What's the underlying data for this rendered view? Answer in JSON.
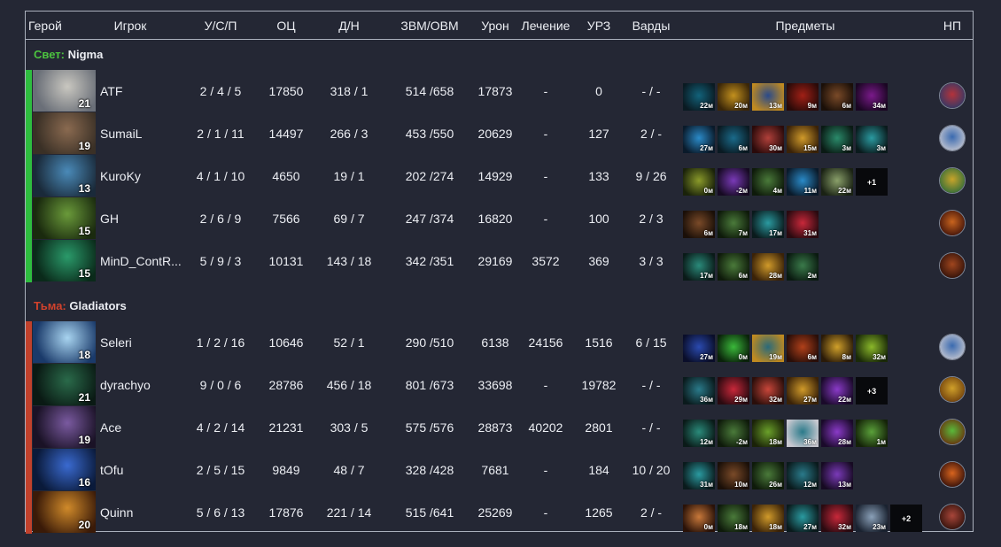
{
  "headers": {
    "hero": "Герой",
    "player": "Игрок",
    "kda": "У/С/П",
    "nw": "ОЦ",
    "lhdn": "Д/Н",
    "gpmxpm": "ЗВМ/ОВМ",
    "damage": "Урон",
    "heal": "Лечение",
    "tower_damage": "УРЗ",
    "wards": "Варды",
    "items": "Предметы",
    "np": "НП"
  },
  "teams": [
    {
      "side": "Свет:",
      "name": "Nigma",
      "side_color": "#4cc33f",
      "bar_color": "#2ebd3f",
      "rows": [
        {
          "level": "21",
          "player": "ATF",
          "kda": "2 / 4 / 5",
          "nw": "17850",
          "lhdn": "318 / 1",
          "gpmxpm": "514 /658",
          "damage": "17873",
          "heal": "-",
          "td": "0",
          "wards": "- / -",
          "portrait": [
            "#c9c7c0",
            "#6a6f78"
          ],
          "items": [
            {
              "t": "22м",
              "c": [
                "#12627a",
                "#0a1a22"
              ]
            },
            {
              "t": "20м",
              "c": [
                "#c2901e",
                "#3a2608"
              ]
            },
            {
              "t": "13м",
              "c": [
                "#2a4a8a",
                "#c08a20"
              ]
            },
            {
              "t": "9м",
              "c": [
                "#a02016",
                "#2a0a08"
              ]
            },
            {
              "t": "6м",
              "c": [
                "#7a4a28",
                "#1a0f08"
              ]
            },
            {
              "t": "34м",
              "c": [
                "#7a1a8a",
                "#1a0622"
              ]
            }
          ],
          "np": [
            "#b4323a",
            "#2a3a6a"
          ]
        },
        {
          "level": "19",
          "player": "SumaiL",
          "kda": "2 / 1 / 11",
          "nw": "14497",
          "lhdn": "266 / 3",
          "gpmxpm": "453 /550",
          "damage": "20629",
          "heal": "-",
          "td": "127",
          "wards": "2 / -",
          "portrait": [
            "#8a6a50",
            "#3a3026"
          ],
          "items": [
            {
              "t": "27м",
              "c": [
                "#2a8ac8",
                "#0a1a2a"
              ]
            },
            {
              "t": "6м",
              "c": [
                "#1a6a8a",
                "#0a1a22"
              ]
            },
            {
              "t": "30м",
              "c": [
                "#b0403a",
                "#2a0a0a"
              ]
            },
            {
              "t": "15м",
              "c": [
                "#d09a2a",
                "#3a2208"
              ]
            },
            {
              "t": "3м",
              "c": [
                "#2a8a6a",
                "#0a1a14"
              ]
            },
            {
              "t": "3м",
              "c": [
                "#2a9aa0",
                "#0a1a1c"
              ]
            }
          ],
          "np": [
            "#3a6ab0",
            "#c8c8d0"
          ]
        },
        {
          "level": "13",
          "player": "KuroKy",
          "kda": "4 / 1 / 10",
          "nw": "4650",
          "lhdn": "19 / 1",
          "gpmxpm": "202 /274",
          "damage": "14929",
          "heal": "-",
          "td": "133",
          "wards": "9 / 26",
          "portrait": [
            "#4a8ab8",
            "#1a2a3a"
          ],
          "items": [
            {
              "t": "0м",
              "c": [
                "#8a9a2a",
                "#1a220a"
              ]
            },
            {
              "t": "-2м",
              "c": [
                "#7a3ab8",
                "#160a22"
              ]
            },
            {
              "t": "4м",
              "c": [
                "#4a7a3a",
                "#0e1a0a"
              ]
            },
            {
              "t": "11м",
              "c": [
                "#2a8ac8",
                "#0a1a2a"
              ]
            },
            {
              "t": "22м",
              "c": [
                "#8aa06a",
                "#1a2214"
              ]
            },
            {
              "t": "+1",
              "more": true
            }
          ],
          "np": [
            "#c8a42a",
            "#2a6a3a"
          ]
        },
        {
          "level": "15",
          "player": "GH",
          "kda": "2 / 6 / 9",
          "nw": "7566",
          "lhdn": "69 / 7",
          "gpmxpm": "247 /374",
          "damage": "16820",
          "heal": "-",
          "td": "100",
          "wards": "2 / 3",
          "portrait": [
            "#6a9a3a",
            "#1a2a0e"
          ],
          "items": [
            {
              "t": "6м",
              "c": [
                "#7a4a28",
                "#1a0f08"
              ]
            },
            {
              "t": "7м",
              "c": [
                "#4a7a3a",
                "#0e1a0a"
              ]
            },
            {
              "t": "17м",
              "c": [
                "#2a9aa0",
                "#0a1a1c"
              ]
            },
            {
              "t": "31м",
              "c": [
                "#c8283a",
                "#2a0a10"
              ]
            }
          ],
          "np": [
            "#c8641e",
            "#3a0e08"
          ]
        },
        {
          "level": "15",
          "player": "MinD_ContR...",
          "kda": "5 / 9 / 3",
          "nw": "10131",
          "lhdn": "143 / 18",
          "gpmxpm": "342 /351",
          "damage": "29169",
          "heal": "3572",
          "td": "369",
          "wards": "3 / 3",
          "portrait": [
            "#2a9a6a",
            "#0a2a1a"
          ],
          "items": [
            {
              "t": "17м",
              "c": [
                "#2a8a7a",
                "#0a1a18"
              ]
            },
            {
              "t": "6м",
              "c": [
                "#4a7a3a",
                "#0e1a0a"
              ]
            },
            {
              "t": "28м",
              "c": [
                "#d09a2a",
                "#3a2208"
              ]
            },
            {
              "t": "2м",
              "c": [
                "#3a7a4a",
                "#0a1a10"
              ]
            }
          ],
          "np": [
            "#a0461e",
            "#2a0e08"
          ]
        }
      ]
    },
    {
      "side": "Тьма:",
      "name": "Gladiators",
      "side_color": "#d2422c",
      "bar_color": "#c0412c",
      "rows": [
        {
          "level": "18",
          "player": "Seleri",
          "kda": "1 / 2 / 16",
          "nw": "10646",
          "lhdn": "52 / 1",
          "gpmxpm": "290 /510",
          "damage": "6138",
          "heal": "24156",
          "td": "1516",
          "wards": "6 / 15",
          "portrait": [
            "#a8d4f0",
            "#1a3a6a"
          ],
          "items": [
            {
              "t": "27м",
              "c": [
                "#2a4ab0",
                "#0a0e2a"
              ]
            },
            {
              "t": "0м",
              "c": [
                "#3ab83a",
                "#0a220a"
              ]
            },
            {
              "t": "19м",
              "c": [
                "#2a6a7a",
                "#c08a20"
              ]
            },
            {
              "t": "6м",
              "c": [
                "#b0401a",
                "#2a0e08"
              ]
            },
            {
              "t": "8м",
              "c": [
                "#d0a02a",
                "#2a1a08"
              ]
            },
            {
              "t": "32м",
              "c": [
                "#8ab82a",
                "#1a2a08"
              ]
            }
          ],
          "np": [
            "#3a6ab0",
            "#c8c8d0"
          ]
        },
        {
          "level": "21",
          "player": "dyrachyo",
          "kda": "9 / 0 / 6",
          "nw": "28786",
          "lhdn": "456 / 18",
          "gpmxpm": "801 /673",
          "damage": "33698",
          "heal": "-",
          "td": "19782",
          "wards": "- / -",
          "portrait": [
            "#2a6a4a",
            "#0a1a14"
          ],
          "items": [
            {
              "t": "36м",
              "c": [
                "#2a7a8a",
                "#0a1a1c"
              ]
            },
            {
              "t": "29м",
              "c": [
                "#c8283a",
                "#2a0a10"
              ]
            },
            {
              "t": "32м",
              "c": [
                "#c8463a",
                "#2a0e0a"
              ]
            },
            {
              "t": "27м",
              "c": [
                "#d09a2a",
                "#3a2208"
              ]
            },
            {
              "t": "22м",
              "c": [
                "#8a3ac8",
                "#1a0a2a"
              ]
            },
            {
              "t": "+3",
              "more": true
            }
          ],
          "np": [
            "#d0a02a",
            "#6a3a0a"
          ]
        },
        {
          "level": "19",
          "player": "Ace",
          "kda": "4 / 2 / 14",
          "nw": "21231",
          "lhdn": "303 / 5",
          "gpmxpm": "575 /576",
          "damage": "28873",
          "heal": "40202",
          "td": "2801",
          "wards": "- / -",
          "portrait": [
            "#7a5aa0",
            "#1a1226"
          ],
          "items": [
            {
              "t": "12м",
              "c": [
                "#2a8a7a",
                "#0a1a18"
              ]
            },
            {
              "t": "-2м",
              "c": [
                "#4a7a3a",
                "#0e1a0a"
              ]
            },
            {
              "t": "18м",
              "c": [
                "#6aa02a",
                "#1a2208"
              ]
            },
            {
              "t": "36м",
              "c": [
                "#2a7a8a",
                "#c8c8d0"
              ]
            },
            {
              "t": "28м",
              "c": [
                "#8a3ac8",
                "#1a0a2a"
              ]
            },
            {
              "t": "1м",
              "c": [
                "#5aa03a",
                "#142208"
              ]
            }
          ],
          "np": [
            "#5ab83a",
            "#6a2a0a"
          ]
        },
        {
          "level": "16",
          "player": "tOfu",
          "kda": "2 / 5 / 15",
          "nw": "9849",
          "lhdn": "48 / 7",
          "gpmxpm": "328 /428",
          "damage": "7681",
          "heal": "-",
          "td": "184",
          "wards": "10 / 20",
          "portrait": [
            "#3a6ad0",
            "#0a1a3a"
          ],
          "items": [
            {
              "t": "31м",
              "c": [
                "#2a9aa0",
                "#0a1a1c"
              ]
            },
            {
              "t": "10м",
              "c": [
                "#7a4a28",
                "#1a0f08"
              ]
            },
            {
              "t": "26м",
              "c": [
                "#4a7a3a",
                "#0e1a0a"
              ]
            },
            {
              "t": "12м",
              "c": [
                "#2a7a8a",
                "#0a1a1c"
              ]
            },
            {
              "t": "13м",
              "c": [
                "#7a3ab8",
                "#160a22"
              ]
            }
          ],
          "np": [
            "#d8641e",
            "#2a0a08"
          ]
        },
        {
          "level": "20",
          "player": "Quinn",
          "kda": "5 / 6 / 13",
          "nw": "17876",
          "lhdn": "221 / 14",
          "gpmxpm": "515 /641",
          "damage": "25269",
          "heal": "-",
          "td": "1265",
          "wards": "2 / -",
          "portrait": [
            "#d08a2a",
            "#3a1a08"
          ],
          "items": [
            {
              "t": "0м",
              "c": [
                "#c8783a",
                "#2a1208"
              ]
            },
            {
              "t": "18м",
              "c": [
                "#4a7a3a",
                "#0e1a0a"
              ]
            },
            {
              "t": "18м",
              "c": [
                "#d09a2a",
                "#3a2208"
              ]
            },
            {
              "t": "27м",
              "c": [
                "#2a9aa0",
                "#0a1a1c"
              ]
            },
            {
              "t": "32м",
              "c": [
                "#c8283a",
                "#2a0a10"
              ]
            },
            {
              "t": "23м",
              "c": [
                "#8aa0b8",
                "#1a2230"
              ]
            },
            {
              "t": "+2",
              "more": true
            }
          ],
          "np": [
            "#a8463a",
            "#2a0e08"
          ]
        }
      ]
    }
  ]
}
